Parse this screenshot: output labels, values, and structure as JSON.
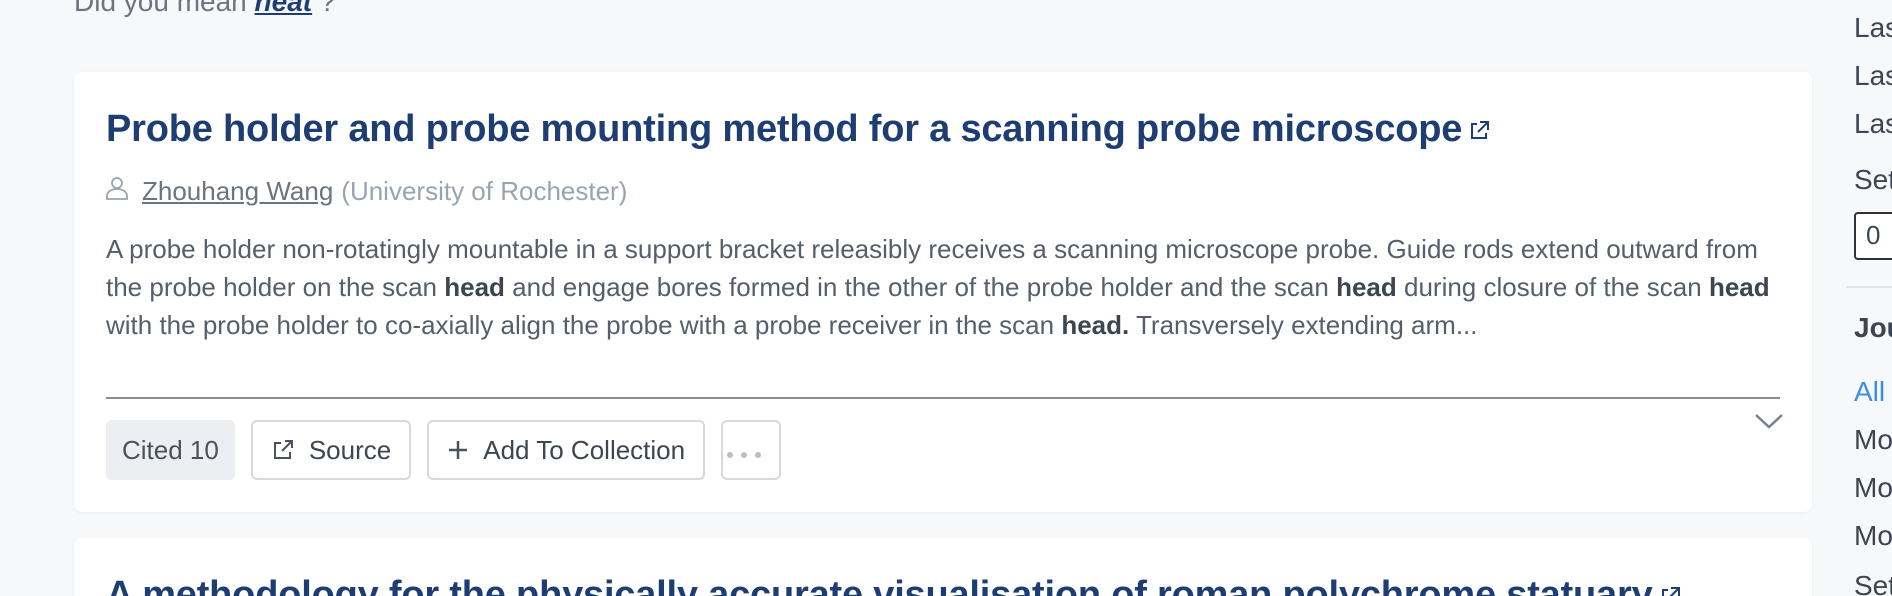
{
  "did_you_mean": {
    "prefix": "Did you mean",
    "suggestion": "heat",
    "suffix": "?"
  },
  "results": [
    {
      "title": "Probe holder and probe mounting method for a scanning probe microscope",
      "author": "Zhouhang Wang",
      "affiliation": "(University of Rochester)",
      "abstract_parts": [
        "A probe holder non-rotatingly mountable in a support bracket releasibly receives a scanning microscope probe. Guide rods extend outward from the probe holder on the scan ",
        "head",
        " and engage bores formed in the other of the probe holder and the scan ",
        "head",
        " during closure of the scan ",
        "head",
        " with the probe holder to co-axially align the probe with a probe receiver in the scan ",
        "head.",
        " Transversely extending arm..."
      ],
      "cited": "Cited 10",
      "source_label": "Source",
      "add_collection_label": "Add To Collection",
      "more_label": "•••"
    },
    {
      "title": "A methodology for the physically accurate visualisation of roman polychrome statuary"
    }
  ],
  "sidebar": {
    "items_top": [
      "Las",
      "Las",
      "Las"
    ],
    "set_label": "Set",
    "set_value": "0",
    "journal_heading": "Jou",
    "all_label": "All",
    "items_bottom": [
      "Mo",
      "Mo",
      "Mo"
    ],
    "set_label_2": "Set"
  },
  "colors": {
    "title": "#1e3e73",
    "accent_blue": "#3b8de6",
    "muted": "#9aa3b0"
  }
}
